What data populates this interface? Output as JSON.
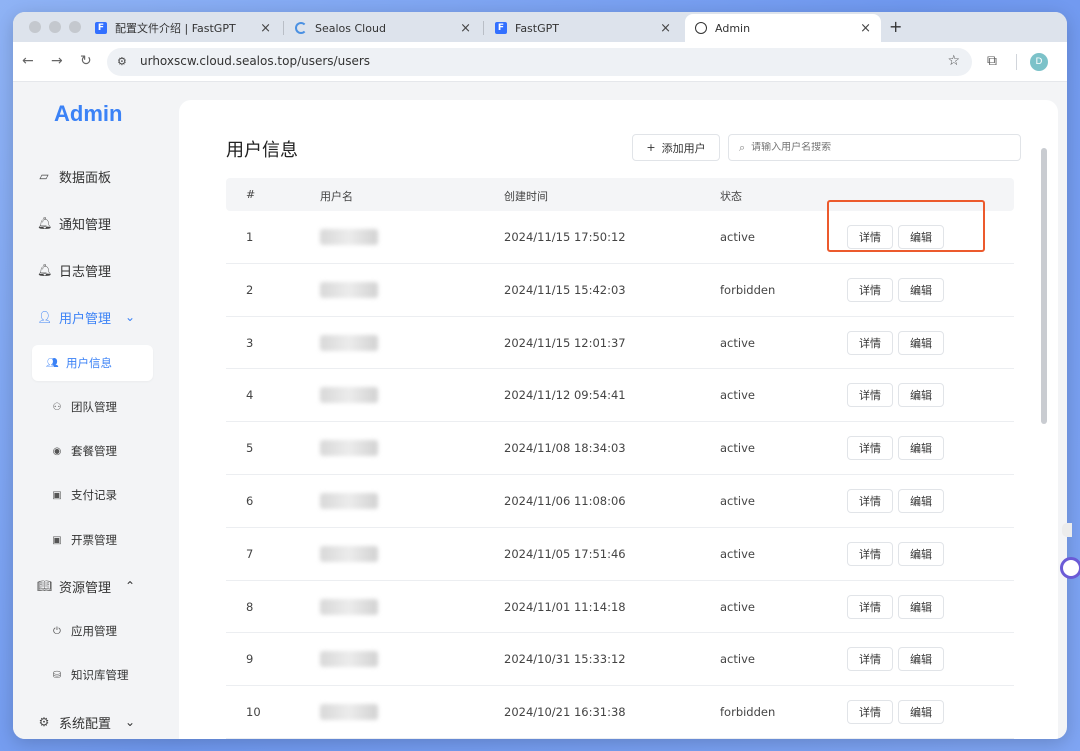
{
  "browser": {
    "tabs": [
      {
        "title": "配置文件介绍 | FastGPT",
        "icon": "fastgpt-icon"
      },
      {
        "title": "Sealos Cloud",
        "icon": "sealos-icon"
      },
      {
        "title": "FastGPT",
        "icon": "fastgpt-icon"
      },
      {
        "title": "Admin",
        "icon": "globe-icon"
      }
    ],
    "tab_close": "×",
    "new_tab": "+",
    "url": "urhoxscw.cloud.sealos.top/users/users",
    "profile_initial": "D",
    "favicon_letter": "F"
  },
  "sidebar": {
    "brand": "Admin",
    "items": [
      {
        "label": "数据面板",
        "icon": "dashboard-icon"
      },
      {
        "label": "通知管理",
        "icon": "bell-icon"
      },
      {
        "label": "日志管理",
        "icon": "bell-icon"
      },
      {
        "label": "用户管理",
        "icon": "user-icon",
        "chevron": "⌄"
      },
      {
        "label": "资源管理",
        "icon": "book-icon",
        "chevron": "⌃"
      },
      {
        "label": "系统配置",
        "icon": "gear-icon",
        "chevron": "⌄"
      }
    ],
    "user_sub": [
      {
        "label": "用户信息",
        "icon": "user-info-icon"
      },
      {
        "label": "团队管理",
        "icon": "team-icon"
      },
      {
        "label": "套餐管理",
        "icon": "package-icon"
      },
      {
        "label": "支付记录",
        "icon": "payment-icon"
      },
      {
        "label": "开票管理",
        "icon": "invoice-icon"
      }
    ],
    "resource_sub": [
      {
        "label": "应用管理",
        "icon": "app-icon"
      },
      {
        "label": "知识库管理",
        "icon": "database-icon"
      }
    ]
  },
  "main": {
    "title": "用户信息",
    "add_button": "添加用户",
    "add_plus": "+",
    "search_placeholder": "请输入用户名搜索",
    "columns": [
      "#",
      "用户名",
      "创建时间",
      "状态"
    ],
    "detail_label": "详情",
    "edit_label": "编辑",
    "rows": [
      {
        "num": "1",
        "time": "2024/11/15 17:50:12",
        "status": "active"
      },
      {
        "num": "2",
        "time": "2024/11/15 15:42:03",
        "status": "forbidden"
      },
      {
        "num": "3",
        "time": "2024/11/15 12:01:37",
        "status": "active"
      },
      {
        "num": "4",
        "time": "2024/11/12 09:54:41",
        "status": "active"
      },
      {
        "num": "5",
        "time": "2024/11/08 18:34:03",
        "status": "active"
      },
      {
        "num": "6",
        "time": "2024/11/06 11:08:06",
        "status": "active"
      },
      {
        "num": "7",
        "time": "2024/11/05 17:51:46",
        "status": "active"
      },
      {
        "num": "8",
        "time": "2024/11/01 11:14:18",
        "status": "active"
      },
      {
        "num": "9",
        "time": "2024/10/31 15:33:12",
        "status": "active"
      },
      {
        "num": "10",
        "time": "2024/10/21 16:31:38",
        "status": "forbidden"
      }
    ]
  },
  "colors": {
    "accent": "#3b82f6",
    "highlight": "#ec5a2d"
  }
}
